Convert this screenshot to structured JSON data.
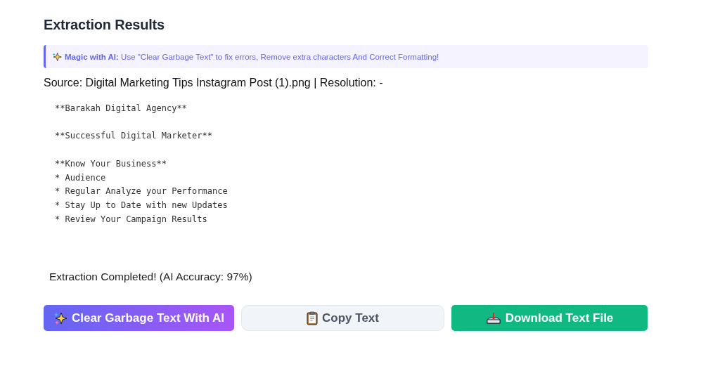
{
  "heading": "Extraction Results",
  "notice": {
    "label": "Magic with AI:",
    "text": "Use \"Clear Garbage Text\" to fix errors, Remove extra characters And Correct Formatting!"
  },
  "source_line": "Source: Digital Marketing Tips Instagram Post (1).png | Resolution: -",
  "extracted_text": "**Barakah Digital Agency**\n\n**Successful Digital Marketer**\n\n**Know Your Business**\n* Audience\n* Regular Analyze your Performance\n* Stay Up to Date with new Updates\n* Review Your Campaign Results",
  "status": "Extraction Completed! (AI Accuracy: 97%)",
  "buttons": [
    {
      "kind": "ai",
      "label": "Clear Garbage Text With AI"
    },
    {
      "kind": "copy",
      "label": "Copy Text"
    },
    {
      "kind": "download",
      "label": "Download Text File"
    }
  ]
}
